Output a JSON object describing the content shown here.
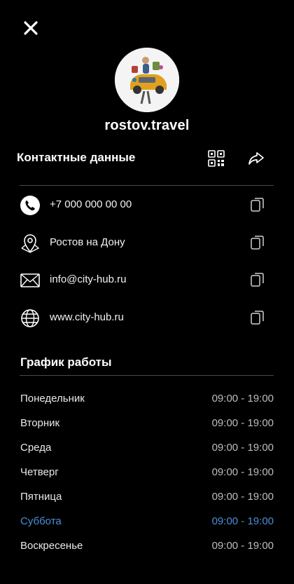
{
  "profile": {
    "username": "rostov.travel"
  },
  "contacts": {
    "title": "Контактные данные",
    "items": [
      {
        "icon": "phone-icon",
        "text": "+7 000 000 00 00"
      },
      {
        "icon": "location-icon",
        "text": "Ростов на Дону"
      },
      {
        "icon": "mail-icon",
        "text": "info@city-hub.ru"
      },
      {
        "icon": "globe-icon",
        "text": "www.city-hub.ru"
      }
    ]
  },
  "schedule": {
    "title": "График работы",
    "days": [
      {
        "day": "Понедельник",
        "hours": "09:00 - 19:00"
      },
      {
        "day": "Вторник",
        "hours": "09:00 - 19:00"
      },
      {
        "day": "Среда",
        "hours": "09:00 - 19:00"
      },
      {
        "day": "Четверг",
        "hours": "09:00 - 19:00"
      },
      {
        "day": "Пятница",
        "hours": "09:00 - 19:00"
      },
      {
        "day": "Суббота",
        "hours": "09:00 - 19:00",
        "today": true
      },
      {
        "day": "Воскресенье",
        "hours": "09:00 - 19:00"
      }
    ]
  },
  "colors": {
    "background": "#000000",
    "text": "#ffffff",
    "muted": "#bdbdbd",
    "accent": "#4a8fd6",
    "divider": "#4a4a4a"
  }
}
